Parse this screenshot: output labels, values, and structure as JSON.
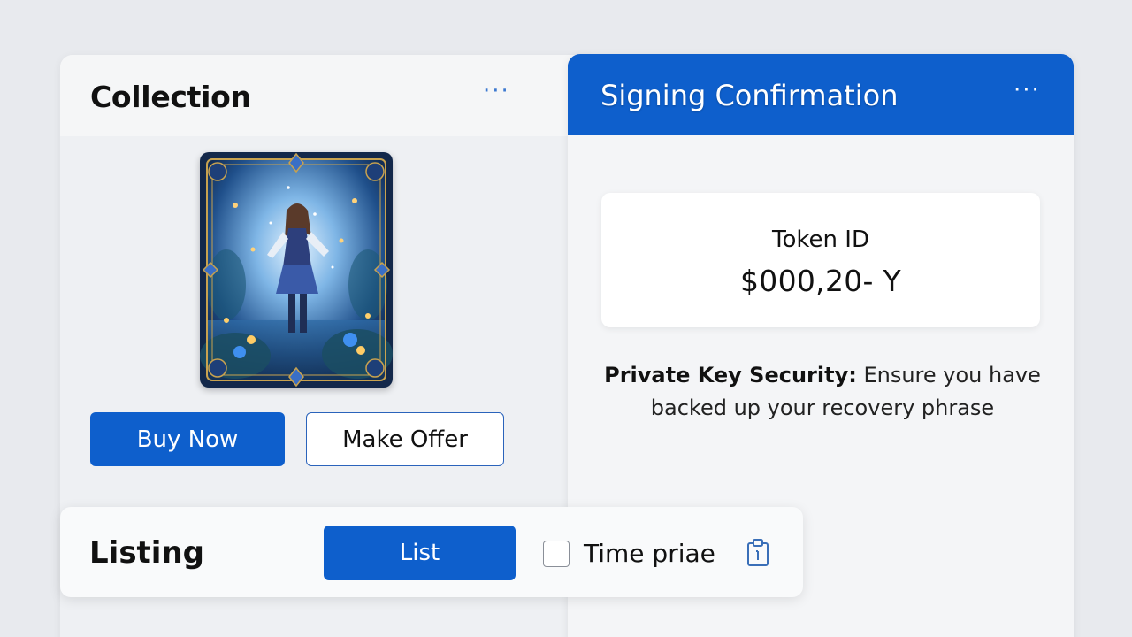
{
  "collection": {
    "title": "Collection",
    "more_icon": "more-horizontal-icon",
    "nft_image": "fantasy-heroine-card-art",
    "buy_label": "Buy Now",
    "offer_label": "Make Offer"
  },
  "signing": {
    "title": "Signing Confirmation",
    "more_icon": "more-horizontal-icon",
    "token_label": "Token ID",
    "token_value": "$000,20- Y",
    "security_title": "Private Key Security:",
    "security_text": "Ensure you have backed up your recovery phrase"
  },
  "listing": {
    "title": "Listing",
    "list_label": "List",
    "checkbox_label": "Time priae",
    "checkbox_checked": false,
    "clipboard_icon": "clipboard-icon"
  },
  "colors": {
    "primary": "#0e5fcc",
    "background": "#e8eaee",
    "panel": "#f4f5f7"
  }
}
